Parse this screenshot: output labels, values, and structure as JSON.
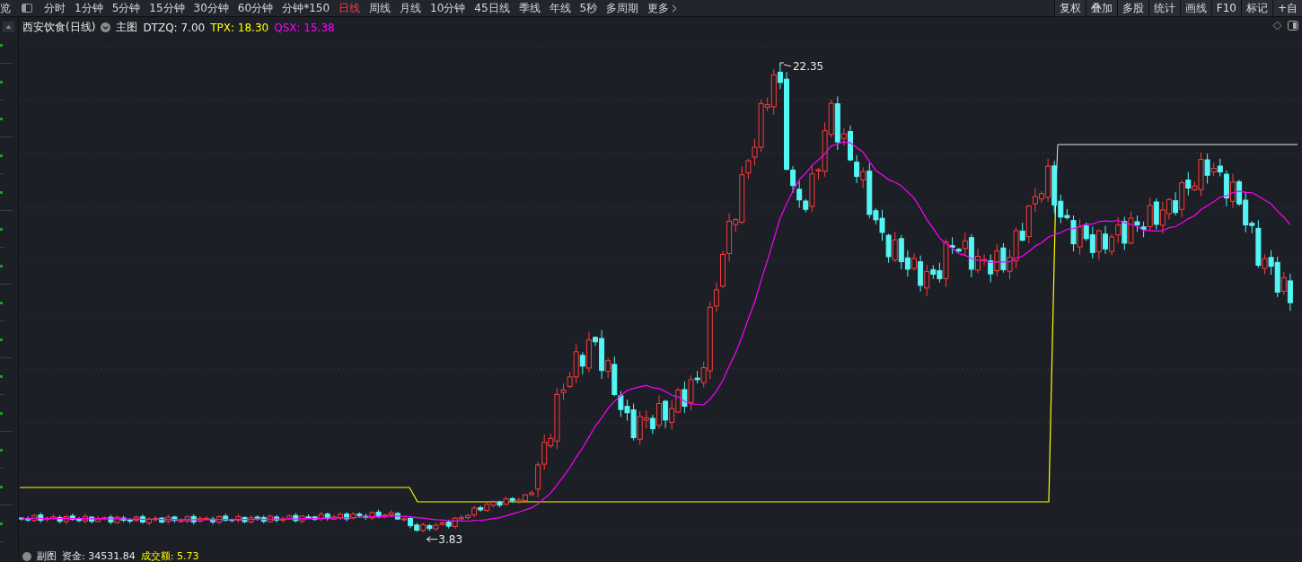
{
  "toolbar": {
    "left_cut_label": "览",
    "periods": [
      {
        "label": "分时",
        "selected": false
      },
      {
        "label": "1分钟",
        "selected": false
      },
      {
        "label": "5分钟",
        "selected": false
      },
      {
        "label": "15分钟",
        "selected": false
      },
      {
        "label": "30分钟",
        "selected": false
      },
      {
        "label": "60分钟",
        "selected": false
      },
      {
        "label": "分钟*150",
        "selected": false
      },
      {
        "label": "日线",
        "selected": true
      },
      {
        "label": "周线",
        "selected": false
      },
      {
        "label": "月线",
        "selected": false
      },
      {
        "label": "10分钟",
        "selected": false
      },
      {
        "label": "45日线",
        "selected": false
      },
      {
        "label": "季线",
        "selected": false
      },
      {
        "label": "年线",
        "selected": false
      },
      {
        "label": "5秒",
        "selected": false
      },
      {
        "label": "多周期",
        "selected": false
      }
    ],
    "more": "更多",
    "buttons": [
      "复权",
      "叠加",
      "多股",
      "统计",
      "画线",
      "F10",
      "标记",
      "+自"
    ]
  },
  "main_chart": {
    "title": "西安饮食(日线)",
    "panel_label": "主图",
    "indicators": [
      {
        "label": "DTZQ: 7.00",
        "color": "#e8e8e8"
      },
      {
        "label": "TPX: 18.30",
        "color": "#ffff00"
      },
      {
        "label": "QSX: 15.38",
        "color": "#ff00ff"
      }
    ],
    "high_label": "22.35",
    "low_label": "3.83"
  },
  "sub_chart": {
    "panel_label": "副图",
    "values": [
      {
        "label": "资金: 34531.84",
        "color": "#e8e8e8"
      },
      {
        "label": "成交额: 5.73",
        "color": "#ffff00"
      }
    ]
  }
}
